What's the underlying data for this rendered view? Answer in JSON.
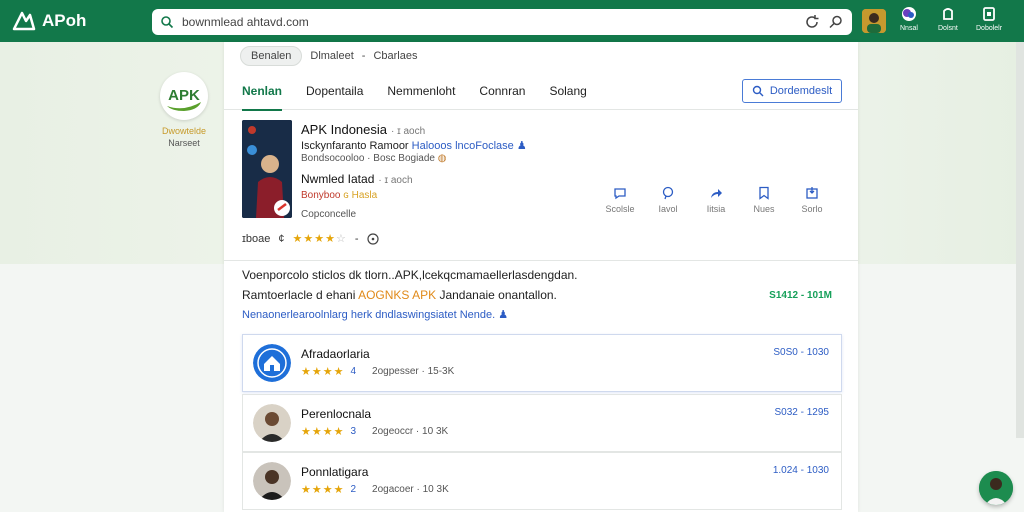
{
  "app": {
    "logo_text": "APoh"
  },
  "search": {
    "url": "bownmlead ahtavd.com"
  },
  "topbar_right": [
    {
      "label": "Nnsal",
      "icon": "profile-icon"
    },
    {
      "label": "Dolsnt",
      "icon": "android-icon"
    },
    {
      "label": "Dobolelr",
      "icon": "app-icon"
    }
  ],
  "side": {
    "logo_text": "APK",
    "name": "Dwowtelde",
    "sub": "Narseet"
  },
  "breadcrumb": {
    "item1": "Benalen",
    "item2": "Dlmaleet",
    "sep": "-",
    "item3": "Cbarlaes"
  },
  "tabs": [
    "Nenlan",
    "Dopentaila",
    "Nemmenloht",
    "Connran",
    "Solang"
  ],
  "download_button": "Dordemdeslt",
  "featured": {
    "title": "APK Indonesia",
    "title_meta": "· ɪ aoch",
    "line2_prefix": "Isckynfaranto Ramoor",
    "line2_blue": "Halooos lncoFoclase",
    "line3": "Bondsocooloo · Bosc Bogiade",
    "title2": "Nwmled Iatad",
    "title2_meta": "· ɪ aoch",
    "line4_red": "Bonyboo",
    "line4_yellow": "ɢ Hasla",
    "line5": "Copconcelle",
    "rating_label": "ɪboae",
    "rating_mark": "¢",
    "stars_on": "★★★★",
    "stars_off": "☆",
    "stars_sep": "-"
  },
  "actions": [
    {
      "label": "Scolsle",
      "icon": "chat-icon"
    },
    {
      "label": "Iavol",
      "icon": "share-icon"
    },
    {
      "label": "Iitsia",
      "icon": "bookmark-icon"
    },
    {
      "label": "Nues",
      "icon": "flag-icon"
    },
    {
      "label": "Sorlo",
      "icon": "save-icon"
    }
  ],
  "description": {
    "line1": "Voenporcolo sticlos dk tlorn..APK,lcekqcmamaellerlasdengdan.",
    "line2_prefix": "Ramtoerlacle d ehani",
    "line2_orange": "AOGNKS APK",
    "line2_suffix": "Jandanaie onantallon.",
    "line3": "Nenaonerlearoolnlarg herk dndlaswingsiatet Nende.",
    "size": "S1412 - 101M"
  },
  "related": [
    {
      "name": "Afradaorlaria",
      "stars": "★★★★",
      "num": "4",
      "meta": "2ogpesser · 15-3K",
      "size": "S0S0 - 1030",
      "icon": "home-badge-icon"
    },
    {
      "name": "Perenlocnala",
      "stars": "★★★★",
      "num": "3",
      "meta": "2ogeoccr · 10 3K",
      "size": "S032 - 1295",
      "icon": "person-avatar-icon"
    },
    {
      "name": "Ponnlatigara",
      "stars": "★★★★",
      "num": "2",
      "meta": "2ogacoer · 10 3K",
      "size": "1.024 - 1030",
      "icon": "person-avatar-icon"
    }
  ],
  "colors": {
    "brand": "#12784a",
    "accent_blue": "#2c5cc4",
    "star": "#e5a50a",
    "size_green": "#16a05a"
  }
}
